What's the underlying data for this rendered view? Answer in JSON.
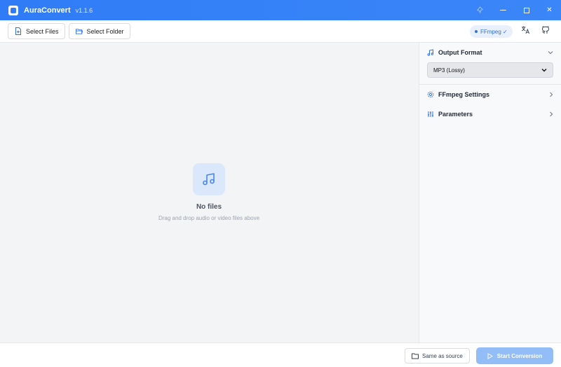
{
  "app": {
    "title": "AuraConvert",
    "version": "v1.1.6",
    "accent_color": "#2f7cf6"
  },
  "window_controls": {
    "pin_icon": "pin-icon",
    "minimize_glyph": "—",
    "maximize_glyph": "☐",
    "close_glyph": "✕"
  },
  "toolbar": {
    "select_files_label": "Select Files",
    "select_folder_label": "Select Folder",
    "ffmpeg_badge": "FFmpeg ✓",
    "ffmpeg_badge_color": "#2f6fed",
    "translate_icon": "translate-icon",
    "github_icon": "github-icon"
  },
  "empty_state": {
    "icon": "music-note-icon",
    "title": "No files",
    "subtitle": "Drag and drop audio or video files above"
  },
  "sidebar": {
    "output_format": {
      "label": "Output Format",
      "selected": "MP3 (Lossy)",
      "expanded": true
    },
    "ffmpeg_settings": {
      "label": "FFmpeg Settings",
      "expanded": false
    },
    "parameters": {
      "label": "Parameters",
      "expanded": false
    }
  },
  "footer": {
    "same_as_source_label": "Same as source",
    "start_conversion_label": "Start Conversion",
    "start_button_color": "#93bdf6"
  }
}
